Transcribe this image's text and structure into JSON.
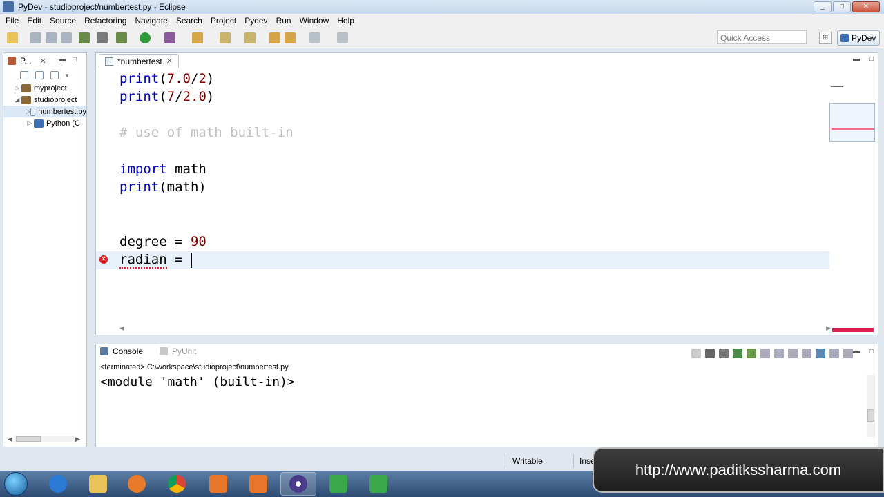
{
  "window": {
    "title": "PyDev - studioproject/numbertest.py - Eclipse"
  },
  "menu": [
    "File",
    "Edit",
    "Source",
    "Refactoring",
    "Navigate",
    "Search",
    "Project",
    "Pydev",
    "Run",
    "Window",
    "Help"
  ],
  "toolbar": {
    "quick_access_placeholder": "Quick Access",
    "perspective_label": "PyDev"
  },
  "left_panel": {
    "tab_label": "P...",
    "tree": [
      {
        "label": "myproject",
        "icon": "project-icon"
      },
      {
        "label": "studioproject",
        "icon": "project-icon"
      },
      {
        "label": "numbertest.py",
        "icon": "python-file-icon"
      },
      {
        "label": "Python (C",
        "icon": "python-interpreter-icon"
      }
    ]
  },
  "editor": {
    "tab_label": "*numbertest",
    "code_lines": [
      {
        "kw": "print",
        "rest": "(",
        "num": "7.0",
        "rest2": "/",
        "num2": "2",
        "end": ")"
      },
      {
        "kw": "print",
        "rest": "(",
        "num": "7",
        "rest2": "/",
        "num2": "2.0",
        "end": ")"
      },
      {
        "comment": "# use of math built-in"
      },
      {
        "kw": "import",
        "rest": " math"
      },
      {
        "kw": "print",
        "rest": "(math)"
      },
      {
        "plain": "degree = ",
        "num": "90"
      },
      {
        "err": "radian",
        "plain": " = "
      }
    ]
  },
  "console": {
    "tabs": [
      "Console",
      "PyUnit"
    ],
    "terminated": "<terminated> C:\\workspace\\studioproject\\numbertest.py",
    "output": "<module 'math' (built-in)>"
  },
  "status": {
    "writable": "Writable",
    "insert": "Inse"
  },
  "overlay": {
    "url": "http://www.paditkssharma.com"
  },
  "colors": {
    "keyword": "#0000c8",
    "number": "#800000",
    "comment": "#c0c0c0",
    "error": "#e02020",
    "accent": "#3d6fb4"
  }
}
